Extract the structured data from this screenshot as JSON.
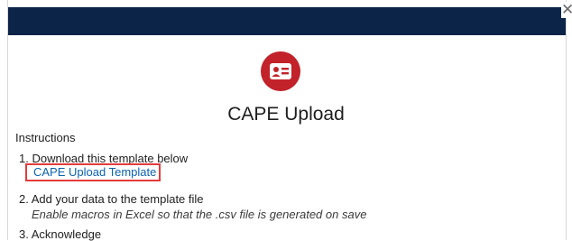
{
  "dialog": {
    "close_glyph": "✕",
    "title": "CAPE Upload",
    "icon": "contact-card-icon",
    "accent_color": "#c2222a",
    "header_color": "#0c2448"
  },
  "instructions": {
    "label": "Instructions",
    "steps": [
      {
        "text": "1. Download this template below",
        "link_label": "CAPE Upload Template"
      },
      {
        "text": "2. Add your data to the template file",
        "note": "Enable macros in Excel so that the .csv file is generated on save"
      },
      {
        "text": "3. Acknowledge"
      }
    ]
  }
}
